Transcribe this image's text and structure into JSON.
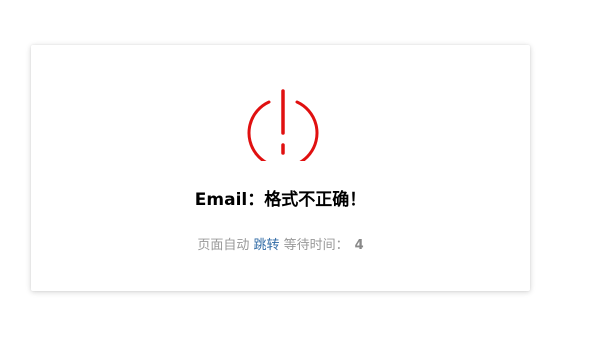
{
  "notice": {
    "icon": "power-warning-icon",
    "icon_color": "#e01010",
    "message": "Email：格式不正确！"
  },
  "redirect": {
    "prefix": "页面自动",
    "link_label": "跳转",
    "suffix": "等待时间：",
    "seconds": "4",
    "link_color": "#2f6aa5"
  }
}
